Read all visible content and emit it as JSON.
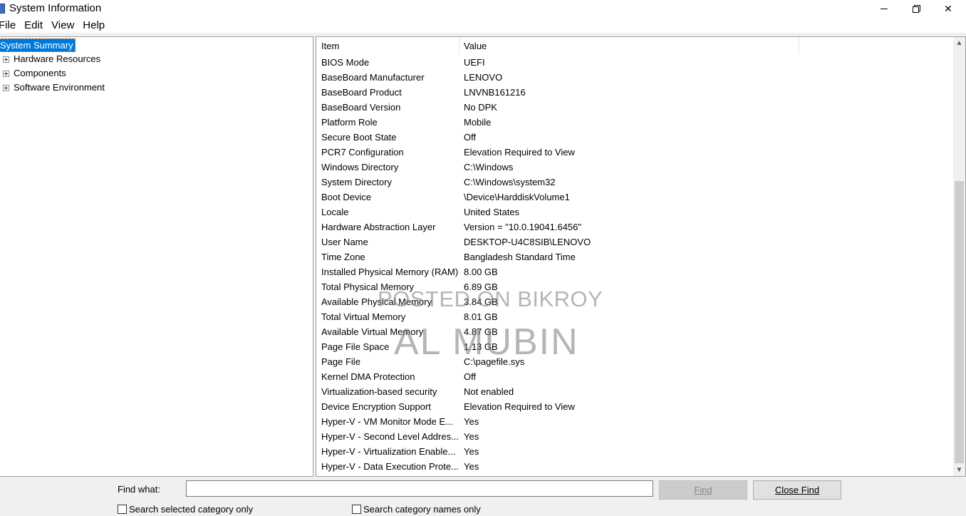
{
  "window": {
    "title": "System Information"
  },
  "menu": [
    "File",
    "Edit",
    "View",
    "Help"
  ],
  "tree": {
    "root": "System Summary",
    "children": [
      "Hardware Resources",
      "Components",
      "Software Environment"
    ]
  },
  "list": {
    "headers": {
      "item": "Item",
      "value": "Value"
    },
    "rows": [
      {
        "item": "BIOS Mode",
        "value": "UEFI"
      },
      {
        "item": "BaseBoard Manufacturer",
        "value": "LENOVO"
      },
      {
        "item": "BaseBoard Product",
        "value": "LNVNB161216"
      },
      {
        "item": "BaseBoard Version",
        "value": "No DPK"
      },
      {
        "item": "Platform Role",
        "value": "Mobile"
      },
      {
        "item": "Secure Boot State",
        "value": "Off"
      },
      {
        "item": "PCR7 Configuration",
        "value": "Elevation Required to View"
      },
      {
        "item": "Windows Directory",
        "value": "C:\\Windows"
      },
      {
        "item": "System Directory",
        "value": "C:\\Windows\\system32"
      },
      {
        "item": "Boot Device",
        "value": "\\Device\\HarddiskVolume1"
      },
      {
        "item": "Locale",
        "value": "United States"
      },
      {
        "item": "Hardware Abstraction Layer",
        "value": "Version = \"10.0.19041.6456\""
      },
      {
        "item": "User Name",
        "value": "DESKTOP-U4C8SIB\\LENOVO"
      },
      {
        "item": "Time Zone",
        "value": "Bangladesh Standard Time"
      },
      {
        "item": "Installed Physical Memory (RAM)",
        "value": "8.00 GB"
      },
      {
        "item": "Total Physical Memory",
        "value": "6.89 GB"
      },
      {
        "item": "Available Physical Memory",
        "value": "3.84 GB"
      },
      {
        "item": "Total Virtual Memory",
        "value": "8.01 GB"
      },
      {
        "item": "Available Virtual Memory",
        "value": "4.87 GB"
      },
      {
        "item": "Page File Space",
        "value": "1.13 GB"
      },
      {
        "item": "Page File",
        "value": "C:\\pagefile.sys"
      },
      {
        "item": "Kernel DMA Protection",
        "value": "Off"
      },
      {
        "item": "Virtualization-based security",
        "value": "Not enabled"
      },
      {
        "item": "Device Encryption Support",
        "value": "Elevation Required to View"
      },
      {
        "item": "Hyper-V - VM Monitor Mode E...",
        "value": "Yes"
      },
      {
        "item": "Hyper-V - Second Level Addres...",
        "value": "Yes"
      },
      {
        "item": "Hyper-V - Virtualization Enable...",
        "value": "Yes"
      },
      {
        "item": "Hyper-V - Data Execution Prote...",
        "value": "Yes"
      }
    ]
  },
  "watermark": {
    "line1": "POSTED ON BIKROY",
    "line2": "AL MUBIN"
  },
  "find": {
    "label": "Find what:",
    "input_value": "",
    "find_button": "Find",
    "close_button": "Close Find",
    "check_selected": "Search selected category only",
    "check_names": "Search category names only"
  },
  "icons": {
    "app": "system-information-icon",
    "expander": "plus-expander-icon",
    "scroll_up": "chevron-up-icon",
    "scroll_down": "chevron-down-icon"
  },
  "colors": {
    "selection": "#0078d7",
    "window_bg": "#f0f0f0",
    "pane_bg": "#ffffff"
  }
}
